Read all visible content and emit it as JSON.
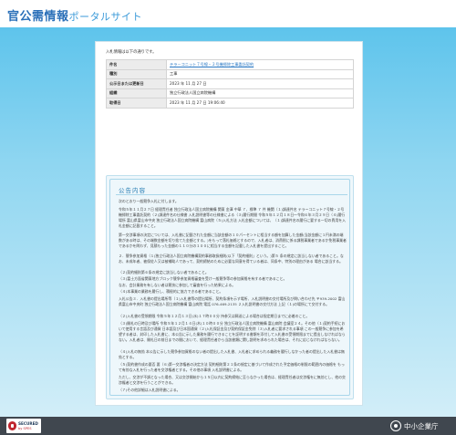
{
  "header": {
    "brand_main": "官公需情報",
    "brand_sub": "ポータルサイト"
  },
  "content": {
    "intro": "入札情報は以下の通りです。",
    "info_rows": [
      {
        "label": "件名",
        "value": "テラ－コニット７号線・２号機掃除工事委託契約",
        "link": true
      },
      {
        "label": "種別",
        "value": "工事",
        "link": false
      },
      {
        "label": "公示日または更新日",
        "value": "2023 年 11 月 27 日",
        "link": false
      },
      {
        "label": "組織",
        "value": "独立行政法人国立病院機構",
        "link": false
      },
      {
        "label": "取得日",
        "value": "2023 年 11 月 27 日 19:06:40",
        "link": false
      }
    ],
    "notice": {
      "title": "公告内容",
      "paragraphs": [
        "次のとおり一般競争入札に付します。",
        "令和５年１１月２７日 経理責任者 独立行政法人国立病院機構 関東 金澤 中華 ７、標準 ７ 件 機関（１)調達件名 テラーコニット７号線・２号機掃除工事委託契約（２)調達件名の仕様書 入札説明書等の仕様書による（３)履行期間 令和５年１２月１８日～令和６年３月２９日（４)履行場所 富山県富山市中央 独立行政法人国立病院機構 富山病院（５)入札方法 入札金額については、（１)調達件名の履行に要する一切の費用を入札金額に記載すること。",
        "第一交渉事項の決定については、入札書に記載された金額に当該金額の１０パーセントに相当する額を加算した金額(当該金額に１円未満の端数がある時は、その端数金額を切り捨てた金額とする。)をもって落札価格とするので、入札者は、消費税に係る課税事業者であるか免税事業者であるかを問わず、見積もった金額の１１０分の１００に相当する金額を記載した入札書を提出すること。",
        "２．競争参加資格（１)独立行政法人国立病院機構契約事務取扱細則(以下「契約細則」という。)第５ 条の規定に該当しない者であること。なお、未成年者、被保佐人又は被補助人であって、契約締結のために必要な同意を得ている者は、同条中、特別の理由がある 場合に該当する。",
        "（２)契約細則第６条の規定に該当しない者であること。",
        "（３)富士方面省関東地方ブロック競争参加資格審査を受け一般競争等の参加資格を有する者であること。",
        "なお、会計業務を有しない者は競技に参加して審査を行った結果による。",
        "（４)本事業の業務を履行し、積極的に協力できる者であること。",
        "入札公告３．入札書の提出場所等（１)入札書等の提出場所、契約条項を示す場所、入札説明書の交付場所及び問い合わせ先 〒939-2002 富山県富山市中央町 独立行政法人国立病院機構 富山病院 電話 076-469-2135 ２入札説明書の交付方法 上記（１)の場所にて交付する。",
        "（２)入札書の受領期限 令和５年１２月１３日(水)１７時００分 持参又は郵送による場合は指定期日までに必着のこと。",
        "（３)開札の日時及び場所 令和５年１２月１４日(木)１０時００分 独立行政法人国立病院機構 富山病院 会議室２４。その他（１)契約手続において使用する言語及び通貨 日本語及び日本国通貨（２)入札保証金及び契約保証金免除（３)入札者に要求される事項 この一般競争に参加を希望する者は、封印した入札書に、本公告に示した業務を履行できることを証明する書類を添付して入札書の受領期限までに提出しなければならない。入札者は、開札日の前日までの間において、経理責任者から当該書類に関し説明を求められた場合は、それに応じなければならない。",
        "（４)入札の無効 本公告に示した競争参加資格のない者の提出した入札書、入札者に求められる義務を履行しなかった者の提出した入札書は無効とする。",
        "（５)契約書作成の要否 要（６)第一交渉権者の決定方法 契約細則第２１条の規定に基づいて作成された予定価格の制限の範囲内の価格を もって有効な入札を行った者を交渉権者とする。その他の事項 入札説明書による。",
        "ただし、交渉が不調となった場合、又は交渉開始から１５日以内に契約締結に至らなかった場合は、経理責任者は交渉権をに無効とし、他の交渉権者と交渉を行うことができる。",
        "（７)その他詳細は入札説明書による。"
      ]
    }
  },
  "footer": {
    "seal_line1": "SECURED",
    "seal_line2": "by SPES",
    "org_name": "中小企業庁"
  },
  "colors": {
    "brand": "#2a6fb8",
    "accent": "#3b9ad9",
    "footer_bg": "#40474f"
  }
}
